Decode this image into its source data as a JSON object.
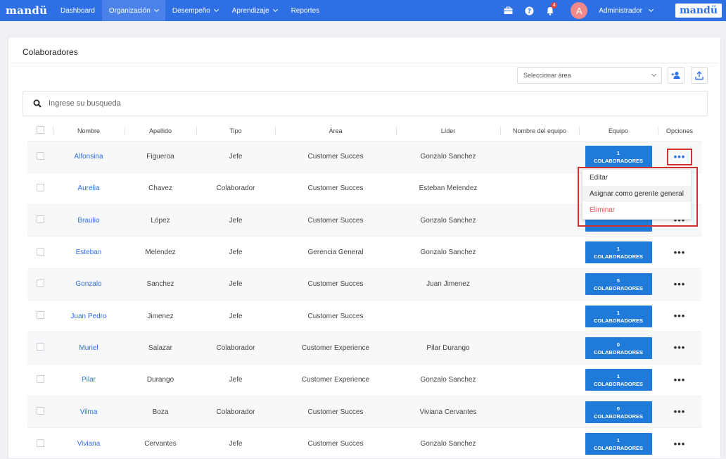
{
  "nav": {
    "brand": "mandü",
    "items": [
      {
        "label": "Dashboard",
        "dropdown": false,
        "active": false
      },
      {
        "label": "Organización",
        "dropdown": true,
        "active": true
      },
      {
        "label": "Desempeño",
        "dropdown": true,
        "active": false
      },
      {
        "label": "Aprendizaje",
        "dropdown": true,
        "active": false
      },
      {
        "label": "Reportes",
        "dropdown": false,
        "active": false
      }
    ],
    "notifications_count": "4",
    "avatar_initial": "A",
    "user_name": "Administrador",
    "logo": "mandü"
  },
  "page": {
    "title": "Colaboradores",
    "area_select": {
      "value": "Seleccionar área"
    },
    "search": {
      "placeholder": "Ingrese su busqueda"
    }
  },
  "table": {
    "headers": [
      "Nombre",
      "Apellido",
      "Tipo",
      "Área",
      "Líder",
      "Nombre del equipo",
      "Equipo",
      "Opciones"
    ],
    "team_suffix": "COLABORADORES",
    "rows": [
      {
        "nombre": "Alfonsina",
        "apellido": "Figueroa",
        "tipo": "Jefe",
        "area": "Customer Succes",
        "lider": "Gonzalo Sanchez",
        "equipo_nombre": "",
        "equipo_count": "1"
      },
      {
        "nombre": "Aurelia",
        "apellido": "Chavez",
        "tipo": "Colaborador",
        "area": "Customer Succes",
        "lider": "Esteban Melendez",
        "equipo_nombre": "",
        "equipo_count": ""
      },
      {
        "nombre": "Braulio",
        "apellido": "López",
        "tipo": "Jefe",
        "area": "Customer Succes",
        "lider": "Gonzalo Sanchez",
        "equipo_nombre": "",
        "equipo_count": ""
      },
      {
        "nombre": "Esteban",
        "apellido": "Melendez",
        "tipo": "Jefe",
        "area": "Gerencia General",
        "lider": "Gonzalo Sanchez",
        "equipo_nombre": "",
        "equipo_count": "1"
      },
      {
        "nombre": "Gonzalo",
        "apellido": "Sanchez",
        "tipo": "Jefe",
        "area": "Customer Succes",
        "lider": "Juan Jimenez",
        "equipo_nombre": "",
        "equipo_count": "5"
      },
      {
        "nombre": "Juan Pedro",
        "apellido": "Jimenez",
        "tipo": "Jefe",
        "area": "Customer Succes",
        "lider": "",
        "equipo_nombre": "",
        "equipo_count": "1"
      },
      {
        "nombre": "Muriel",
        "apellido": "Salazar",
        "tipo": "Colaborador",
        "area": "Customer Experience",
        "lider": "Pilar Durango",
        "equipo_nombre": "",
        "equipo_count": "0"
      },
      {
        "nombre": "Pilar",
        "apellido": "Durango",
        "tipo": "Jefe",
        "area": "Customer Experience",
        "lider": "Gonzalo Sanchez",
        "equipo_nombre": "",
        "equipo_count": "1"
      },
      {
        "nombre": "Vilma",
        "apellido": "Boza",
        "tipo": "Colaborador",
        "area": "Customer Succes",
        "lider": "Viviana Cervantes",
        "equipo_nombre": "",
        "equipo_count": "0"
      },
      {
        "nombre": "Viviana",
        "apellido": "Cervantes",
        "tipo": "Jefe",
        "area": "Customer Succes",
        "lider": "Gonzalo Sanchez",
        "equipo_nombre": "",
        "equipo_count": "1"
      }
    ]
  },
  "options_menu": {
    "open_row": 0,
    "items": [
      {
        "label": "Editar",
        "danger": false
      },
      {
        "label": "Asignar como gerente general",
        "danger": false
      },
      {
        "label": "Eliminar",
        "danger": true
      }
    ]
  },
  "colors": {
    "primary": "#2f6fe4",
    "team_button": "#1f7ad9",
    "danger": "#e05555",
    "highlight": "#d32f2f"
  },
  "icons": [
    "briefcase-icon",
    "help-icon",
    "bell-icon",
    "chevron-down-icon",
    "search-icon",
    "add-user-icon",
    "upload-icon",
    "more-options-icon"
  ]
}
